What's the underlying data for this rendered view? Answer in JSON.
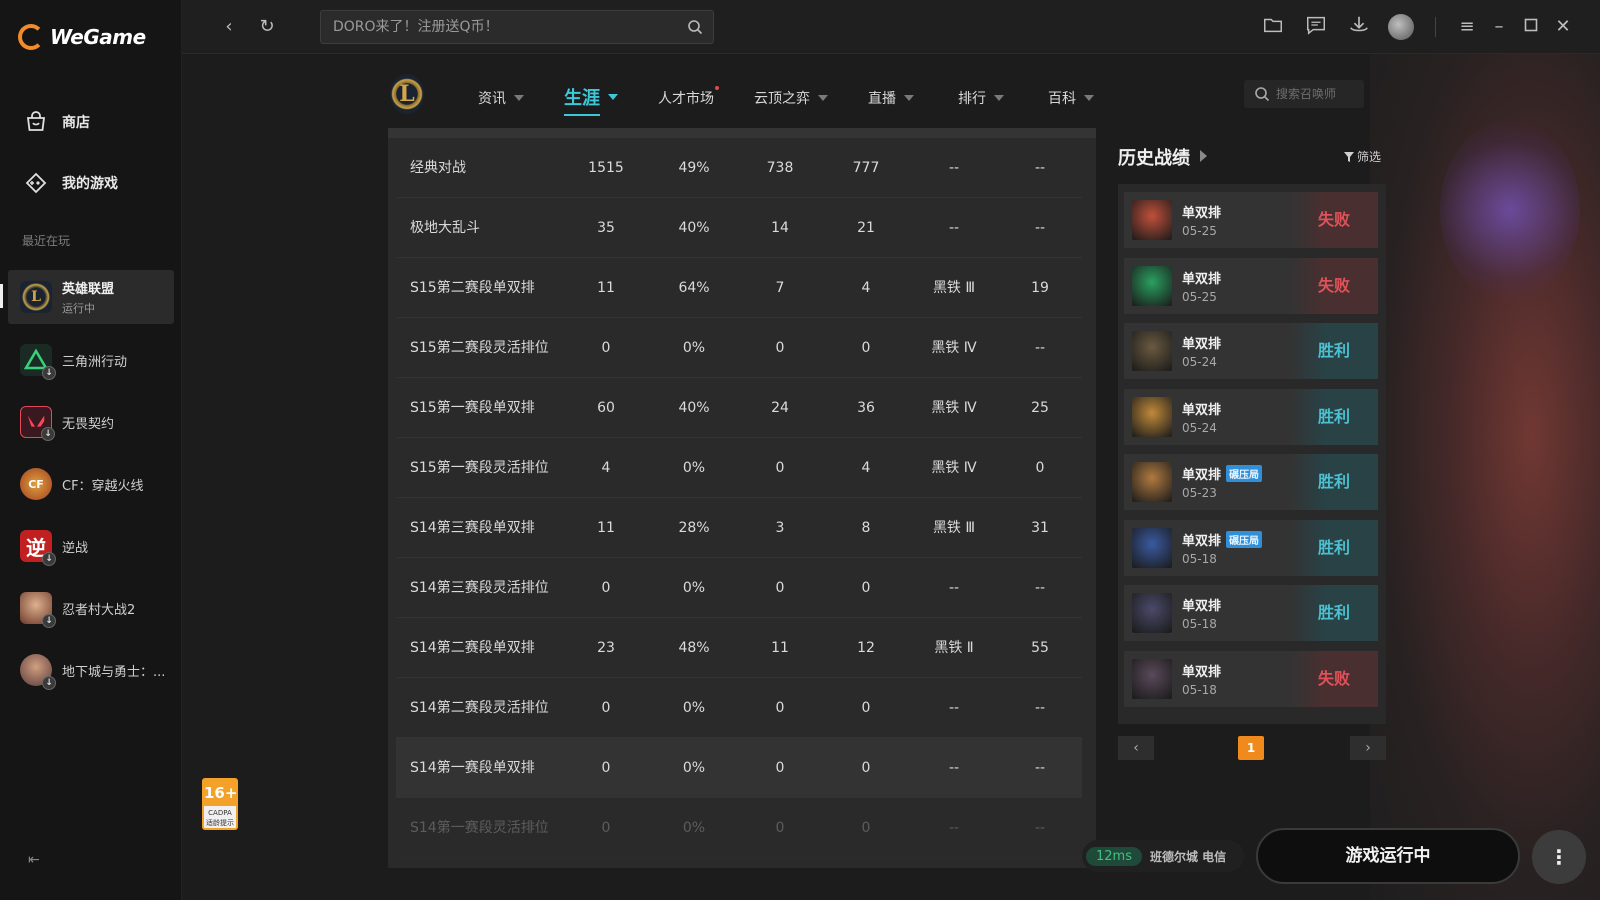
{
  "app": {
    "name": "WeGame"
  },
  "sidebar": {
    "store_label": "商店",
    "mygames_label": "我的游戏",
    "recent_label": "最近在玩",
    "games": [
      {
        "name": "英雄联盟",
        "status": "运行中"
      },
      {
        "name": "三角洲行动"
      },
      {
        "name": "无畏契约"
      },
      {
        "name": "CF：穿越火线"
      },
      {
        "name": "逆战"
      },
      {
        "name": "忍者村大战2"
      },
      {
        "name": "地下城与勇士：..."
      }
    ]
  },
  "topbar": {
    "search_placeholder": "DORO来了！注册送Q币！"
  },
  "game_nav": {
    "logo_letter": "L",
    "tabs": [
      {
        "label": "资讯"
      },
      {
        "label": "生涯"
      },
      {
        "label": "人才市场"
      },
      {
        "label": "云顶之弈"
      },
      {
        "label": "直播"
      },
      {
        "label": "排行"
      },
      {
        "label": "百科"
      }
    ],
    "summoner_search_placeholder": "搜索召唤师"
  },
  "stats_table": {
    "rows": [
      [
        "经典对战",
        "1515",
        "49%",
        "738",
        "777",
        "--",
        "--"
      ],
      [
        "极地大乱斗",
        "35",
        "40%",
        "14",
        "21",
        "--",
        "--"
      ],
      [
        "S15第二赛段单双排",
        "11",
        "64%",
        "7",
        "4",
        "黑铁 Ⅲ",
        "19"
      ],
      [
        "S15第二赛段灵活排位",
        "0",
        "0%",
        "0",
        "0",
        "黑铁 Ⅳ",
        "--"
      ],
      [
        "S15第一赛段单双排",
        "60",
        "40%",
        "24",
        "36",
        "黑铁 Ⅳ",
        "25"
      ],
      [
        "S15第一赛段灵活排位",
        "4",
        "0%",
        "0",
        "4",
        "黑铁 Ⅳ",
        "0"
      ],
      [
        "S14第三赛段单双排",
        "11",
        "28%",
        "3",
        "8",
        "黑铁 Ⅲ",
        "31"
      ],
      [
        "S14第三赛段灵活排位",
        "0",
        "0%",
        "0",
        "0",
        "--",
        "--"
      ],
      [
        "S14第二赛段单双排",
        "23",
        "48%",
        "11",
        "12",
        "黑铁 Ⅱ",
        "55"
      ],
      [
        "S14第二赛段灵活排位",
        "0",
        "0%",
        "0",
        "0",
        "--",
        "--"
      ],
      [
        "S14第一赛段单双排",
        "0",
        "0%",
        "0",
        "0",
        "--",
        "--"
      ],
      [
        "S14第一赛段灵活排位",
        "0",
        "0%",
        "0",
        "0",
        "--",
        "--"
      ]
    ]
  },
  "history": {
    "title": "历史战绩",
    "filter_label": "筛选",
    "matches": [
      {
        "mode": "单双排",
        "date": "05-25",
        "result": "失败",
        "win": false,
        "badge": "",
        "color": "#c0503a"
      },
      {
        "mode": "单双排",
        "date": "05-25",
        "result": "失败",
        "win": false,
        "badge": "",
        "color": "#2aa060"
      },
      {
        "mode": "单双排",
        "date": "05-24",
        "result": "胜利",
        "win": true,
        "badge": "",
        "color": "#6a5a40"
      },
      {
        "mode": "单双排",
        "date": "05-24",
        "result": "胜利",
        "win": true,
        "badge": "",
        "color": "#c08a3a"
      },
      {
        "mode": "单双排",
        "date": "05-23",
        "result": "胜利",
        "win": true,
        "badge": "碾压局",
        "color": "#b07a40"
      },
      {
        "mode": "单双排",
        "date": "05-18",
        "result": "胜利",
        "win": true,
        "badge": "碾压局",
        "color": "#3a5aa0"
      },
      {
        "mode": "单双排",
        "date": "05-18",
        "result": "胜利",
        "win": true,
        "badge": "",
        "color": "#4a4a6a"
      },
      {
        "mode": "单双排",
        "date": "05-18",
        "result": "失败",
        "win": false,
        "badge": "",
        "color": "#5a4a5a"
      }
    ],
    "page": "1"
  },
  "age_rating": {
    "number": "16+",
    "caption": "CADPA 适龄提示"
  },
  "status": {
    "ping": "12ms",
    "server": "班德尔城 电信",
    "run_label": "游戏运行中"
  }
}
